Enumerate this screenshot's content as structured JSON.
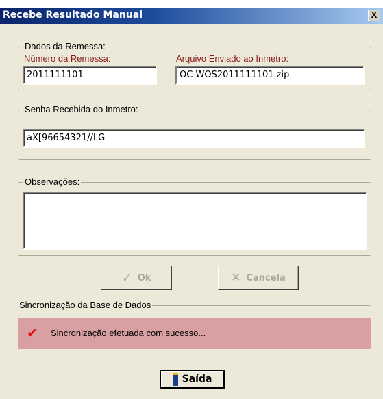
{
  "window": {
    "title": "Recebe Resultado Manual",
    "close_glyph": "X"
  },
  "remessa": {
    "legend": "Dados da Remessa:",
    "numero_label": "Número da Remessa:",
    "numero_value": "2011111101",
    "arquivo_label": "Arquivo Enviado ao Inmetro:",
    "arquivo_value": "OC-WOS2011111101.zip"
  },
  "senha": {
    "legend": "Senha Recebida do Inmetro:",
    "value": "aX[96654321//LG"
  },
  "observacoes": {
    "legend": "Observações:",
    "value": ""
  },
  "buttons": {
    "ok_label": "Ok",
    "cancela_label": "Cancela",
    "saida_label": "Saída"
  },
  "sync": {
    "legend": "Sincronização da Base de Dados",
    "status": "Sincronização efetuada com sucesso...",
    "status_color": "#D8A0A0"
  },
  "icons": {
    "ok": "checkmark-icon",
    "cancela": "x-cross-icon",
    "saida": "exit-door-icon",
    "status": "red-check-icon"
  }
}
